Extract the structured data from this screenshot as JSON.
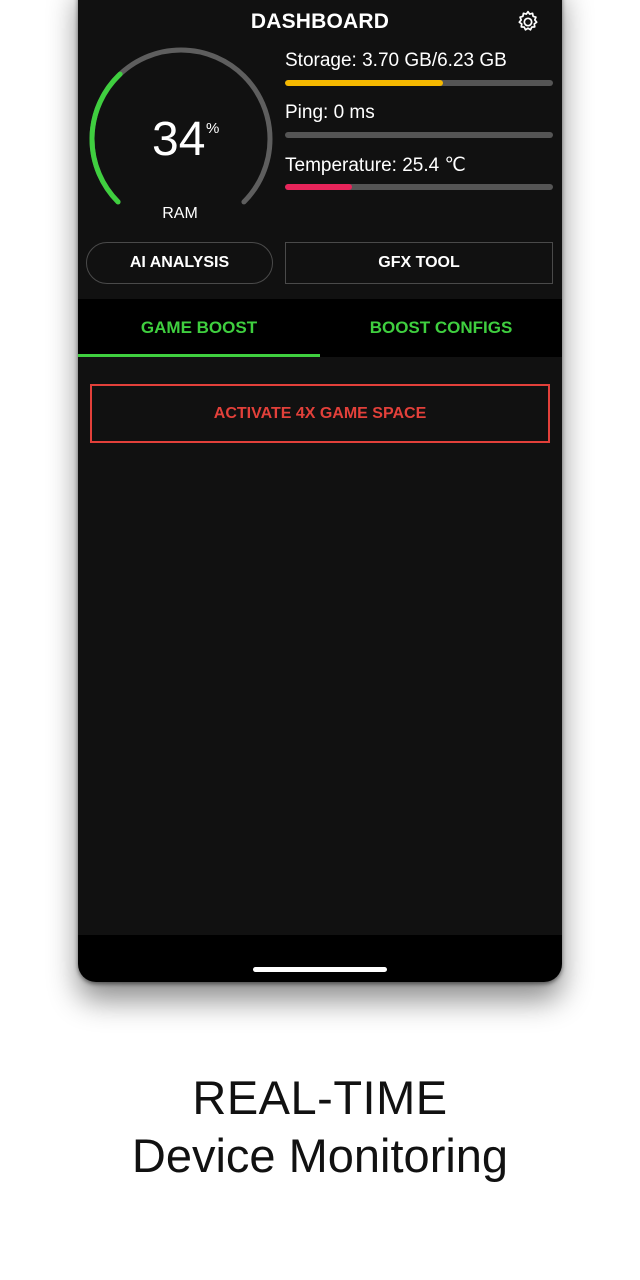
{
  "header": {
    "title": "DASHBOARD"
  },
  "gauge": {
    "value": "34",
    "unit": "%",
    "label": "RAM",
    "fraction": 0.34
  },
  "metrics": [
    {
      "label": "Storage: 3.70 GB/6.23 GB",
      "fraction": 0.59,
      "color": "#f5b800"
    },
    {
      "label": "Ping: 0 ms",
      "fraction": 0.0,
      "color": "#555555"
    },
    {
      "label": "Temperature: 25.4 ℃",
      "fraction": 0.25,
      "color": "#e8245a"
    }
  ],
  "buttons": {
    "ai": "AI ANALYSIS",
    "gfx": "GFX TOOL"
  },
  "tabs": [
    {
      "label": "GAME BOOST"
    },
    {
      "label": "BOOST CONFIGS"
    }
  ],
  "activate": {
    "label": "ACTIVATE 4X GAME SPACE"
  },
  "caption": {
    "line1": "REAL-TIME",
    "line2": "Device Monitoring"
  },
  "colors": {
    "accent": "#3fcf3f",
    "danger": "#e2403a"
  }
}
